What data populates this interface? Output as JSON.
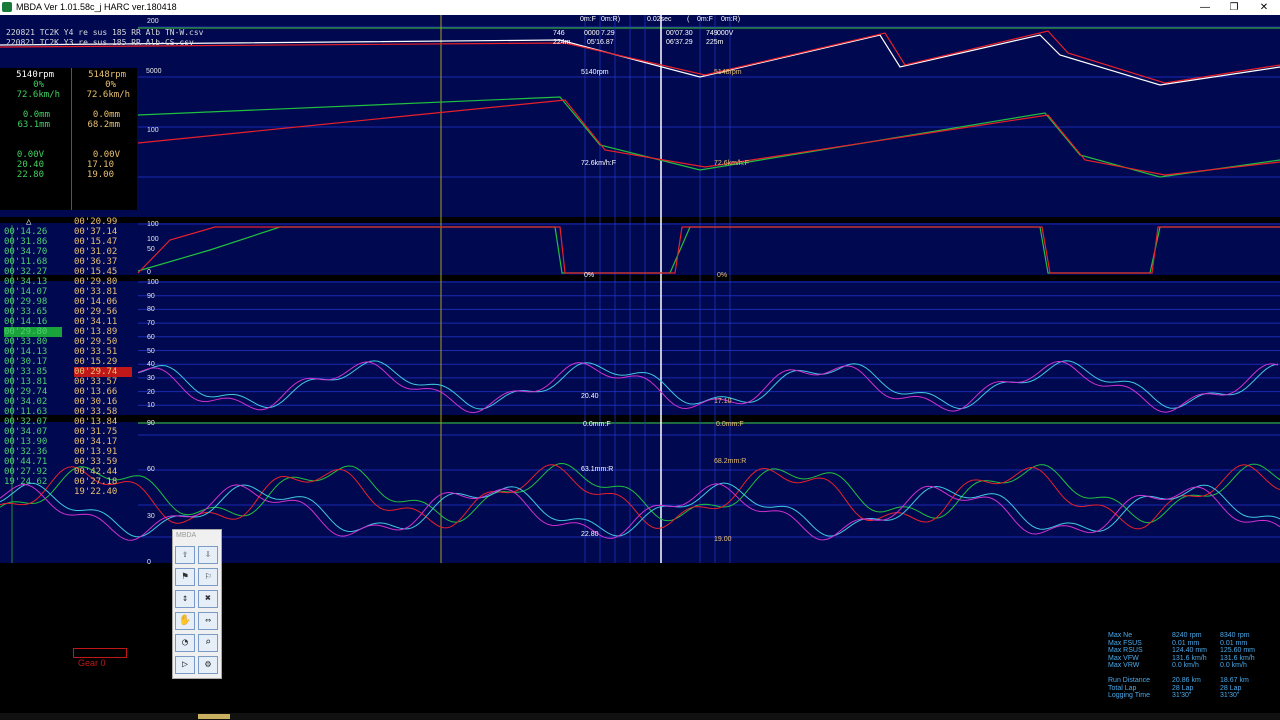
{
  "window": {
    "title": "MBDA Ver 1.01.58c_j HARC ver.180418",
    "controls": [
      "—",
      "❐",
      "✕"
    ]
  },
  "files": [
    {
      "name": "220821 TC2K Y4 re sus 185 RR Alb TN-W.csv",
      "color": "#d8d8d8"
    },
    {
      "name": "220821 TC2K Y3 re sus 185 RR Alb-CS.csv",
      "color": "#d8d8d8"
    }
  ],
  "cursor_top": {
    "mode_a": "0m:F",
    "mode_b": "0m:R)",
    "delta_time": "0.02sec",
    "paren_open": "(",
    "mode_c": "0m:F",
    "mode_d": "0m:R)",
    "c1_rpm_prefix": "746",
    "c1_dist": "224m",
    "c1_rpm": "0000",
    "c1_time_a": "7.29",
    "c1_time_b": "05'16.87",
    "c2_time_a": "00'07.30",
    "c2_rpm": "749",
    "c2_rpm_b": "000V",
    "c2_time_b": "06'37.29",
    "c2_dist": "225m"
  },
  "panel": {
    "a": {
      "rpm": "5140rpm",
      "pct": "0%",
      "speed": "72.6km/h",
      "fsus": "0.0mm",
      "rsus": "63.1mm",
      "volt": "0.00V",
      "v1": "20.40",
      "v2": "22.80"
    },
    "b": {
      "rpm": "5148rpm",
      "pct": "0%",
      "speed": "72.6km/h",
      "fsus": "0.0mm",
      "rsus": "68.2mm",
      "volt": "0.00V",
      "v1": "17.10",
      "v2": "19.00"
    }
  },
  "laps": {
    "marker": "△",
    "col_a": [
      "00'14.26",
      "00'31.86",
      "00'34.70",
      "00'11.68",
      "00'32.27",
      "00'34.13",
      "00'14.07",
      "00'29.98",
      "00'33.65",
      "00'14.16",
      "00'29.80",
      "00'33.80",
      "00'14.13",
      "00'30.17",
      "00'33.85",
      "00'13.81",
      "00'29.74",
      "00'34.02",
      "00'11.63",
      "00'32.07",
      "00'34.07",
      "00'13.90",
      "00'32.36",
      "00'44.71",
      "00'27.92",
      "19'24.62"
    ],
    "col_b": [
      "00'20.99",
      "00'37.14",
      "00'15.47",
      "00'31.02",
      "00'36.37",
      "00'15.45",
      "00'29.80",
      "00'33.81",
      "00'14.06",
      "00'29.56",
      "00'34.11",
      "00'13.89",
      "00'29.50",
      "00'33.51",
      "00'15.29",
      "00'29.74",
      "00'33.57",
      "00'13.66",
      "00'30.16",
      "00'33.58",
      "00'13.84",
      "00'31.75",
      "00'34.17",
      "00'13.91",
      "00'33.59",
      "00'42.44",
      "00'27.18",
      "19'22.40"
    ],
    "best_a_index": 10,
    "best_b_index": 15
  },
  "axes": {
    "rpm": [
      "200",
      "5000"
    ],
    "speed": [
      "100"
    ],
    "throttle": [
      "100",
      "100",
      "50",
      "0"
    ],
    "volt": [
      "100",
      "90",
      "80",
      "70",
      "60",
      "50",
      "40",
      "30",
      "20",
      "10"
    ],
    "sus": [
      "90",
      "60",
      "30",
      "0"
    ]
  },
  "marker_labels": {
    "rpm_a": "5140rpm",
    "rpm_b": "5148rpm",
    "speed_a": "72.6km/h:F",
    "speed_b": "72.6km/h:F",
    "thr_a": "0%",
    "thr_b": "0%",
    "v_a": "20.40",
    "v_b": "17.10",
    "fsus_a": "0.0mm:F",
    "fsus_b": "0.0mm:F",
    "rsus_a": "63.1mm:R",
    "rsus_b": "68.2mm:R",
    "v2_a": "22.80",
    "v2_b": "19.00"
  },
  "toolbox": {
    "title": "MBDA",
    "tools": [
      "chart-add-icon",
      "chart-remove-icon",
      "flag-green-icon",
      "flag-orange-icon",
      "move-vertical-icon",
      "close-cross-icon",
      "hand-pan-icon",
      "arrows-horizontal-icon",
      "gauge-icon",
      "zoom-icon",
      "play-icon",
      "settings-icon"
    ],
    "glyphs": [
      "⇧",
      "⇩",
      "⚑",
      "⚐",
      "↕",
      "✖",
      "✋",
      "⇔",
      "◔",
      "⌕",
      "▷",
      "⚙"
    ]
  },
  "gear": {
    "label": "Gear 0"
  },
  "stats": [
    {
      "k": "Max Ne",
      "a": "8240 rpm",
      "b": "8340 rpm"
    },
    {
      "k": "Max FSUS",
      "a": "0.01 mm",
      "b": "0.01 mm"
    },
    {
      "k": "Max RSUS",
      "a": "124.40 mm",
      "b": "125.60 mm"
    },
    {
      "k": "Max VFW",
      "a": "131.6 km/h",
      "b": "131.6 km/h"
    },
    {
      "k": "Max VRW",
      "a": "0.0 km/h",
      "b": "0.0 km/h"
    },
    {
      "k": "",
      "a": "",
      "b": ""
    },
    {
      "k": "Run Distance",
      "a": "20.86 km",
      "b": "18.67 km"
    },
    {
      "k": "Total Lap",
      "a": "28 Lap",
      "b": "28 Lap"
    },
    {
      "k": "Logging Time",
      "a": "31'30\"",
      "b": "31'30\""
    }
  ],
  "colors": {
    "bg": "#000850",
    "red": "#e8202a",
    "white": "#ffffff",
    "green": "#20c040",
    "magenta": "#d030d0",
    "cyan": "#40c8e0",
    "lapcolA": "#50d070",
    "lapcolB": "#e8c070"
  }
}
